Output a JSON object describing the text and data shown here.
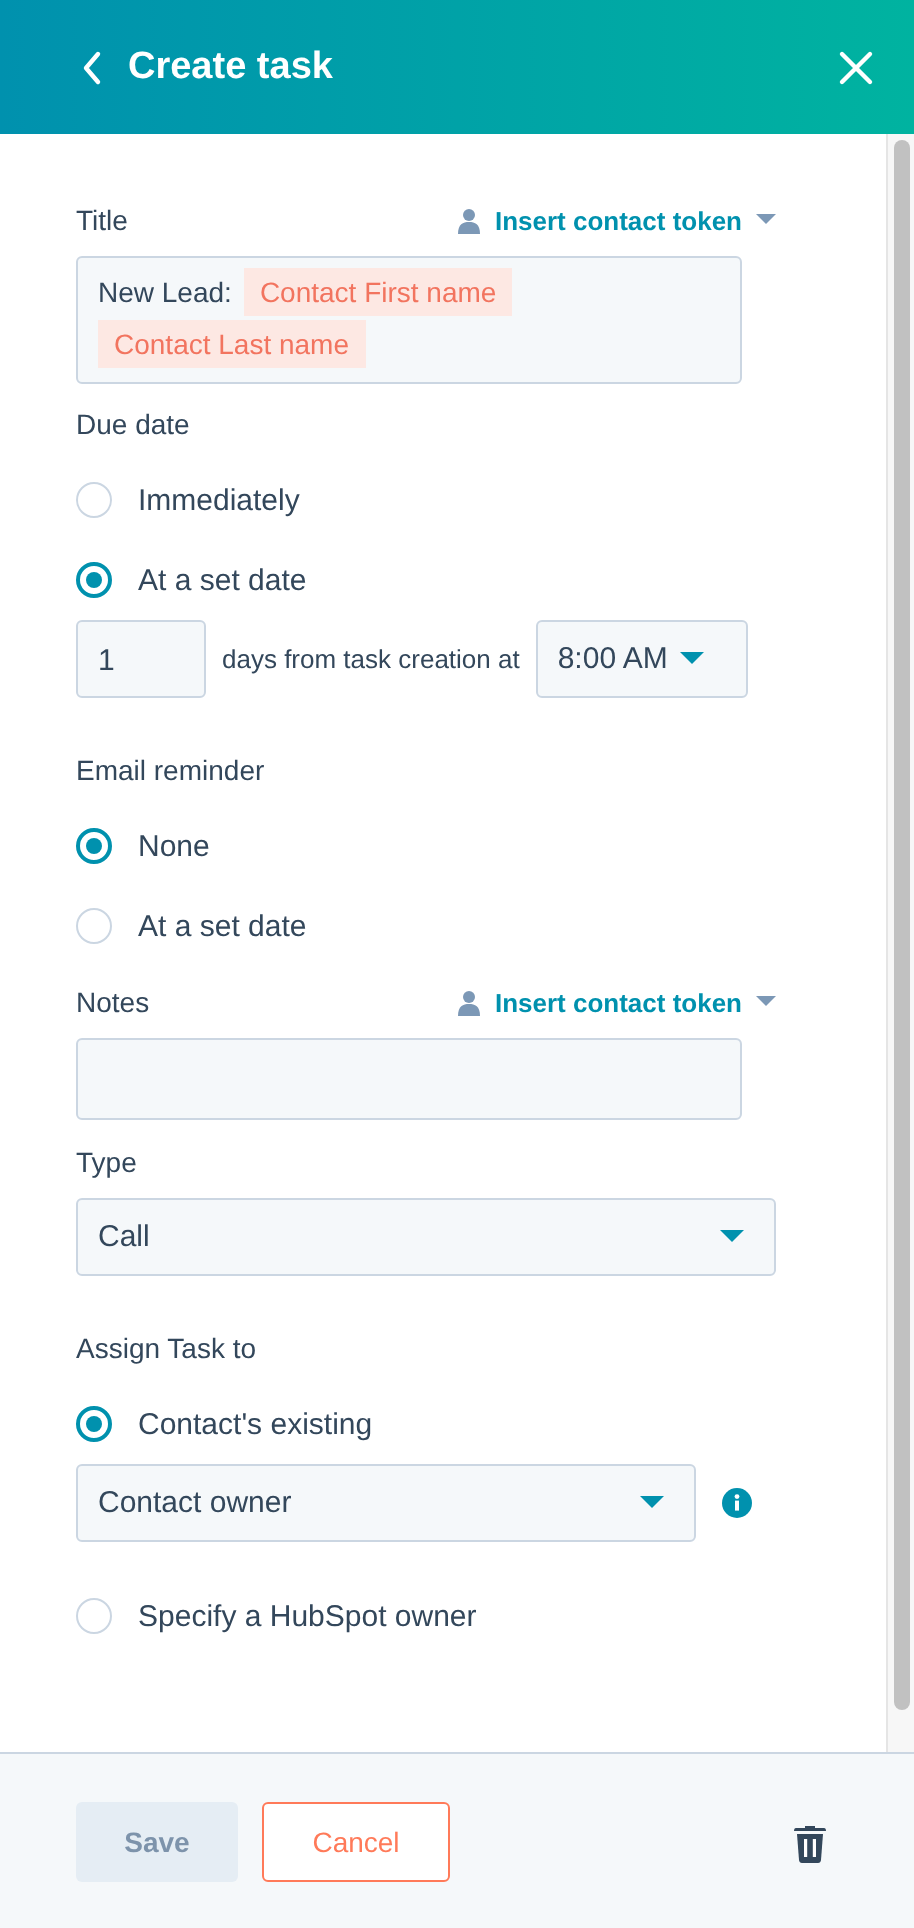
{
  "header": {
    "title": "Create task"
  },
  "title_field": {
    "label": "Title",
    "token_link": "Insert contact token",
    "prefix": "New Lead:",
    "tokens": [
      "Contact First name",
      "Contact Last name"
    ]
  },
  "due_date": {
    "label": "Due date",
    "options": [
      {
        "label": "Immediately",
        "selected": false
      },
      {
        "label": "At a set date",
        "selected": true
      }
    ],
    "days": "1",
    "days_text": "days from task creation at",
    "time": "8:00 AM"
  },
  "email_reminder": {
    "label": "Email reminder",
    "options": [
      {
        "label": "None",
        "selected": true
      },
      {
        "label": "At a set date",
        "selected": false
      }
    ]
  },
  "notes": {
    "label": "Notes",
    "token_link": "Insert contact token"
  },
  "type": {
    "label": "Type",
    "value": "Call"
  },
  "assign": {
    "label": "Assign Task to",
    "options": [
      {
        "label": "Contact's existing",
        "selected": true
      },
      {
        "label": "Specify a HubSpot owner",
        "selected": false
      }
    ],
    "owner": "Contact owner"
  },
  "footer": {
    "save": {
      "label": "Save",
      "disabled": true
    },
    "cancel": "Cancel"
  }
}
